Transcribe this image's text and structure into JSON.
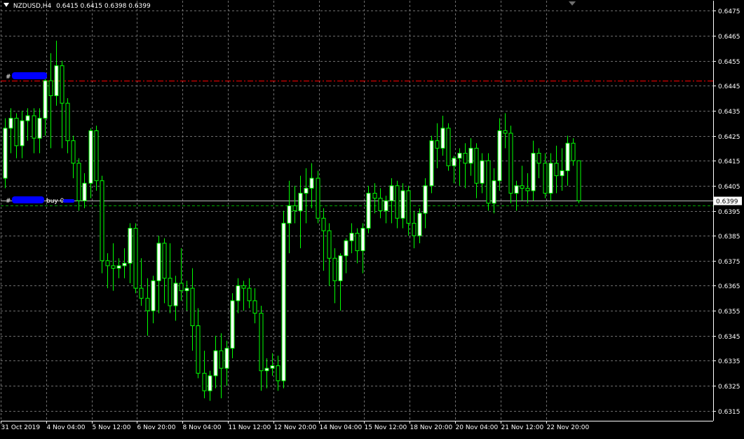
{
  "header": {
    "symbol": "NZDUSD,H4",
    "ohlc": "0.6415 0.6415 0.6398 0.6399"
  },
  "colors": {
    "background": "#000000",
    "grid": "#6e6e6e",
    "candle": "#00ff00",
    "bull_body": "#ffffff",
    "bear_body": "#000000",
    "axis_text": "#ffffff",
    "sell_line": "#ff0000",
    "buy_line": "#00aa00",
    "bid_line": "#c0c0c0",
    "order_label_blot": "#0000ff"
  },
  "order_labels": {
    "top": "#",
    "bottom_prefix": "#",
    "bottom_suffix": "buy 0."
  },
  "chart_data": {
    "type": "candlestick",
    "timeframe": "H4",
    "ylim": [
      0.6311,
      0.6479
    ],
    "y_ticks": [
      "0.6315",
      "0.6325",
      "0.6335",
      "0.6345",
      "0.6355",
      "0.6365",
      "0.6375",
      "0.6385",
      "0.6395",
      "0.6405",
      "0.6415",
      "0.6425",
      "0.6435",
      "0.6445",
      "0.6455",
      "0.6465",
      "0.6475"
    ],
    "current_price": "0.6399",
    "order_levels": [
      {
        "type": "sell",
        "price": 0.6447
      },
      {
        "type": "buy",
        "price": 0.6397
      }
    ],
    "x_ticks": [
      {
        "label": "31 Oct 2019",
        "bar": 0
      },
      {
        "label": "4 Nov 04:00",
        "bar": 8
      },
      {
        "label": "5 Nov 12:00",
        "bar": 16
      },
      {
        "label": "6 Nov 20:00",
        "bar": 24
      },
      {
        "label": "8 Nov 04:00",
        "bar": 32
      },
      {
        "label": "11 Nov 12:00",
        "bar": 40
      },
      {
        "label": "12 Nov 20:00",
        "bar": 48
      },
      {
        "label": "14 Nov 04:00",
        "bar": 56
      },
      {
        "label": "15 Nov 12:00",
        "bar": 64
      },
      {
        "label": "18 Nov 20:00",
        "bar": 72
      },
      {
        "label": "20 Nov 04:00",
        "bar": 80
      },
      {
        "label": "21 Nov 12:00",
        "bar": 88
      },
      {
        "label": "22 Nov 20:00",
        "bar": 96
      }
    ],
    "candles": [
      [
        0.6408,
        0.6432,
        0.6404,
        0.6428
      ],
      [
        0.6428,
        0.6436,
        0.6418,
        0.6432
      ],
      [
        0.6432,
        0.6434,
        0.6416,
        0.6421
      ],
      [
        0.6421,
        0.6435,
        0.6416,
        0.6431
      ],
      [
        0.6431,
        0.6436,
        0.6423,
        0.6433
      ],
      [
        0.6433,
        0.6436,
        0.6418,
        0.6424
      ],
      [
        0.6424,
        0.6436,
        0.6418,
        0.6432
      ],
      [
        0.6432,
        0.645,
        0.6425,
        0.6447
      ],
      [
        0.6447,
        0.6458,
        0.642,
        0.6441
      ],
      [
        0.6441,
        0.6463,
        0.6437,
        0.6453
      ],
      [
        0.6453,
        0.6455,
        0.642,
        0.6438
      ],
      [
        0.6438,
        0.644,
        0.6418,
        0.6423
      ],
      [
        0.6423,
        0.6425,
        0.6408,
        0.6414
      ],
      [
        0.6414,
        0.6416,
        0.6395,
        0.6399
      ],
      [
        0.6399,
        0.641,
        0.6396,
        0.6406
      ],
      [
        0.6406,
        0.6428,
        0.64,
        0.6427
      ],
      [
        0.6427,
        0.6429,
        0.6403,
        0.6407
      ],
      [
        0.6407,
        0.6409,
        0.637,
        0.6375
      ],
      [
        0.6375,
        0.6378,
        0.6364,
        0.6373
      ],
      [
        0.6373,
        0.6382,
        0.6363,
        0.6372
      ],
      [
        0.6372,
        0.6376,
        0.6368,
        0.6373
      ],
      [
        0.6373,
        0.638,
        0.6368,
        0.6374
      ],
      [
        0.6374,
        0.639,
        0.6366,
        0.6388
      ],
      [
        0.6388,
        0.639,
        0.6362,
        0.6364
      ],
      [
        0.6364,
        0.6376,
        0.6357,
        0.636
      ],
      [
        0.636,
        0.6368,
        0.6345,
        0.6355
      ],
      [
        0.6355,
        0.6369,
        0.635,
        0.6367
      ],
      [
        0.6367,
        0.6385,
        0.6354,
        0.6382
      ],
      [
        0.6382,
        0.6384,
        0.6358,
        0.6368
      ],
      [
        0.6368,
        0.6382,
        0.6354,
        0.6357
      ],
      [
        0.6357,
        0.6369,
        0.6351,
        0.6366
      ],
      [
        0.6366,
        0.638,
        0.6359,
        0.6363
      ],
      [
        0.6363,
        0.6367,
        0.6355,
        0.6364
      ],
      [
        0.6364,
        0.6372,
        0.6339,
        0.6349
      ],
      [
        0.6349,
        0.6356,
        0.6328,
        0.633
      ],
      [
        0.633,
        0.6339,
        0.632,
        0.6323
      ],
      [
        0.6323,
        0.6331,
        0.6319,
        0.6329
      ],
      [
        0.6329,
        0.6345,
        0.6324,
        0.6339
      ],
      [
        0.6339,
        0.6346,
        0.632,
        0.6332
      ],
      [
        0.6332,
        0.6343,
        0.6325,
        0.634
      ],
      [
        0.634,
        0.6362,
        0.6336,
        0.6359
      ],
      [
        0.6359,
        0.6368,
        0.6354,
        0.6365
      ],
      [
        0.6365,
        0.6367,
        0.6355,
        0.6364
      ],
      [
        0.6364,
        0.6368,
        0.6356,
        0.6359
      ],
      [
        0.6359,
        0.6364,
        0.635,
        0.6354
      ],
      [
        0.6354,
        0.6357,
        0.6323,
        0.6331
      ],
      [
        0.6331,
        0.6336,
        0.6324,
        0.6332
      ],
      [
        0.6332,
        0.6338,
        0.6329,
        0.6333
      ],
      [
        0.6333,
        0.6337,
        0.6323,
        0.6327
      ],
      [
        0.6327,
        0.6395,
        0.6324,
        0.639
      ],
      [
        0.639,
        0.6407,
        0.6378,
        0.6397
      ],
      [
        0.6397,
        0.6405,
        0.639,
        0.6395
      ],
      [
        0.6395,
        0.6409,
        0.638,
        0.6402
      ],
      [
        0.6402,
        0.6412,
        0.639,
        0.6404
      ],
      [
        0.6404,
        0.6414,
        0.6396,
        0.6408
      ],
      [
        0.6408,
        0.6411,
        0.639,
        0.6392
      ],
      [
        0.6392,
        0.6396,
        0.6371,
        0.6387
      ],
      [
        0.6387,
        0.639,
        0.6365,
        0.6376
      ],
      [
        0.6376,
        0.638,
        0.6358,
        0.6367
      ],
      [
        0.6367,
        0.6378,
        0.6355,
        0.6377
      ],
      [
        0.6377,
        0.6384,
        0.637,
        0.6383
      ],
      [
        0.6383,
        0.639,
        0.6378,
        0.6386
      ],
      [
        0.6386,
        0.6388,
        0.6374,
        0.6379
      ],
      [
        0.6379,
        0.639,
        0.637,
        0.6388
      ],
      [
        0.6388,
        0.6405,
        0.6386,
        0.6402
      ],
      [
        0.6402,
        0.6406,
        0.6394,
        0.64
      ],
      [
        0.64,
        0.6404,
        0.6392,
        0.6395
      ],
      [
        0.6395,
        0.6401,
        0.639,
        0.6399
      ],
      [
        0.6399,
        0.6408,
        0.639,
        0.6405
      ],
      [
        0.6405,
        0.6407,
        0.6388,
        0.6392
      ],
      [
        0.6392,
        0.6406,
        0.6388,
        0.6403
      ],
      [
        0.6403,
        0.6405,
        0.6385,
        0.639
      ],
      [
        0.639,
        0.6395,
        0.638,
        0.6385
      ],
      [
        0.6385,
        0.6396,
        0.6382,
        0.6394
      ],
      [
        0.6394,
        0.6408,
        0.6388,
        0.6405
      ],
      [
        0.6405,
        0.6425,
        0.6402,
        0.6423
      ],
      [
        0.6423,
        0.643,
        0.6412,
        0.642
      ],
      [
        0.642,
        0.6433,
        0.6417,
        0.6428
      ],
      [
        0.6428,
        0.643,
        0.6411,
        0.6413
      ],
      [
        0.6413,
        0.6417,
        0.6406,
        0.6416
      ],
      [
        0.6416,
        0.642,
        0.6405,
        0.6418
      ],
      [
        0.6418,
        0.6422,
        0.6404,
        0.6414
      ],
      [
        0.6414,
        0.6424,
        0.6409,
        0.642
      ],
      [
        0.642,
        0.6422,
        0.64,
        0.6406
      ],
      [
        0.6406,
        0.6418,
        0.6402,
        0.6415
      ],
      [
        0.6415,
        0.6418,
        0.6395,
        0.6398
      ],
      [
        0.6398,
        0.6412,
        0.6394,
        0.6407
      ],
      [
        0.6407,
        0.6432,
        0.6403,
        0.6427
      ],
      [
        0.6427,
        0.6434,
        0.642,
        0.6426
      ],
      [
        0.6426,
        0.6429,
        0.6398,
        0.6402
      ],
      [
        0.6402,
        0.6407,
        0.6395,
        0.6405
      ],
      [
        0.6405,
        0.6413,
        0.6399,
        0.6404
      ],
      [
        0.6404,
        0.641,
        0.6398,
        0.6403
      ],
      [
        0.6403,
        0.6423,
        0.6399,
        0.6418
      ],
      [
        0.6418,
        0.642,
        0.6408,
        0.6414
      ],
      [
        0.6414,
        0.6418,
        0.64,
        0.6402
      ],
      [
        0.6402,
        0.6418,
        0.6399,
        0.6414
      ],
      [
        0.6414,
        0.6421,
        0.6402,
        0.6409
      ],
      [
        0.6409,
        0.642,
        0.6403,
        0.6411
      ],
      [
        0.6411,
        0.6425,
        0.6405,
        0.6422
      ],
      [
        0.6422,
        0.6424,
        0.6413,
        0.6415
      ],
      [
        0.6415,
        0.6415,
        0.6398,
        0.6399
      ]
    ]
  }
}
